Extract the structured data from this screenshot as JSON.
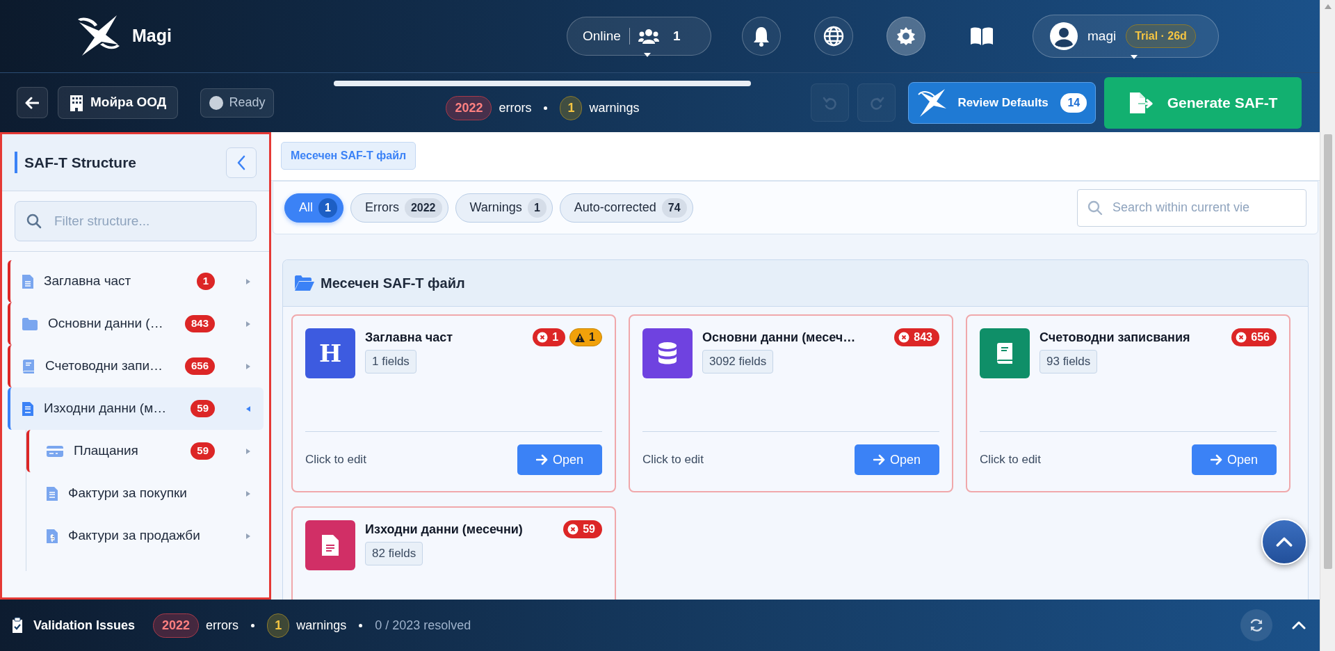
{
  "brand": {
    "name": "Magi"
  },
  "header": {
    "presence": {
      "status": "Online",
      "count": "1"
    },
    "user": {
      "name": "magi",
      "plan": "Trial · 26d"
    }
  },
  "toolbar": {
    "company": "Мойра ООД",
    "status": "Ready",
    "progress": {
      "level": 1
    },
    "errors": {
      "count": "2022",
      "label": "errors"
    },
    "warnings": {
      "count": "1",
      "label": "warnings"
    },
    "undo": {
      "disabled": true
    },
    "redo": {
      "disabled": true
    },
    "review": {
      "label": "Review Defaults",
      "count": "14"
    },
    "generate": {
      "label": "Generate SAF-T"
    }
  },
  "sidebar": {
    "title": "SAF-T Structure",
    "filter": {
      "placeholder": "Filter structure..."
    },
    "items": [
      {
        "label": "Заглавна част",
        "count": "1",
        "selected": false,
        "expanded": false
      },
      {
        "label": "Основни данни (…",
        "count": "843",
        "selected": false,
        "expanded": false
      },
      {
        "label": "Счетоводни запи…",
        "count": "656",
        "selected": false,
        "expanded": false
      },
      {
        "label": "Изходни данни (м…",
        "count": "59",
        "selected": true,
        "expanded": true,
        "children": [
          {
            "label": "Плащания",
            "count": "59",
            "selected": false,
            "expanded": false
          },
          {
            "label": "Фактури за покупки",
            "selected": false,
            "expanded": false
          },
          {
            "label": "Фактури за продажби",
            "selected": false,
            "expanded": false
          }
        ]
      }
    ]
  },
  "breadcrumb": [
    "Месечен SAF-T файл"
  ],
  "filters": {
    "chips": [
      {
        "label": "All",
        "count": "1",
        "selected": true
      },
      {
        "label": "Errors",
        "count": "2022",
        "selected": false
      },
      {
        "label": "Warnings",
        "count": "1",
        "selected": false
      },
      {
        "label": "Auto-corrected",
        "count": "74",
        "selected": false
      }
    ],
    "search": {
      "placeholder": "Search within current vie"
    }
  },
  "section": {
    "title": "Месечен SAF-T файл",
    "cards": [
      {
        "title": "Заглавна част",
        "monogram": "H",
        "color": "#3d5be0",
        "fields": "1 fields",
        "errors": "1",
        "warnings": "1",
        "hint": "Click to edit",
        "action": "Open"
      },
      {
        "title": "Основни данни (месеч…",
        "color": "#6f42e0",
        "fields": "3092 fields",
        "errors": "843",
        "hint": "Click to edit",
        "action": "Open"
      },
      {
        "title": "Счетоводни записвания",
        "color": "#0f8f68",
        "fields": "93 fields",
        "errors": "656",
        "hint": "Click to edit",
        "action": "Open"
      },
      {
        "title": "Изходни данни (месечни)",
        "color": "#d12f66",
        "fields": "82 fields",
        "errors": "59"
      }
    ]
  },
  "footer": {
    "title": "Validation Issues",
    "errors": {
      "count": "2022",
      "label": "errors"
    },
    "warnings": {
      "count": "1",
      "label": "warnings"
    },
    "resolved": "0 / 2023 resolved"
  }
}
